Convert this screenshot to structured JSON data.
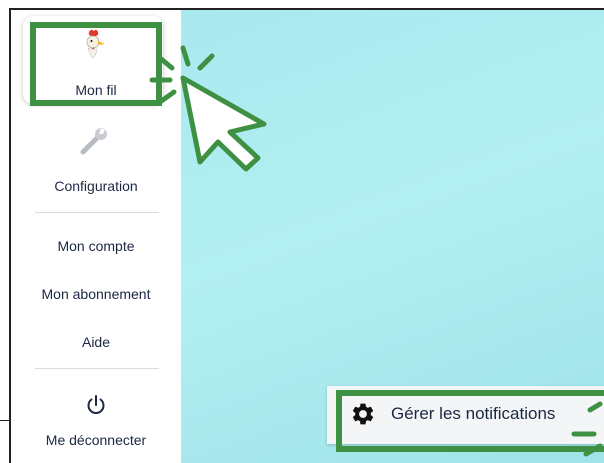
{
  "sidebar": {
    "items": [
      {
        "label": "Mon fil",
        "icon": "rooster-icon"
      },
      {
        "label": "Configuration",
        "icon": "wrench-icon"
      },
      {
        "label": "Mon compte"
      },
      {
        "label": "Mon abonnement"
      },
      {
        "label": "Aide"
      },
      {
        "label": "Me déconnecter",
        "icon": "power-icon"
      }
    ]
  },
  "notification_button": {
    "label": "Gérer les notifications",
    "icon": "gear-icon"
  },
  "colors": {
    "highlight": "#3e9143",
    "background": "#a9e9ee",
    "text": "#1c2742"
  }
}
